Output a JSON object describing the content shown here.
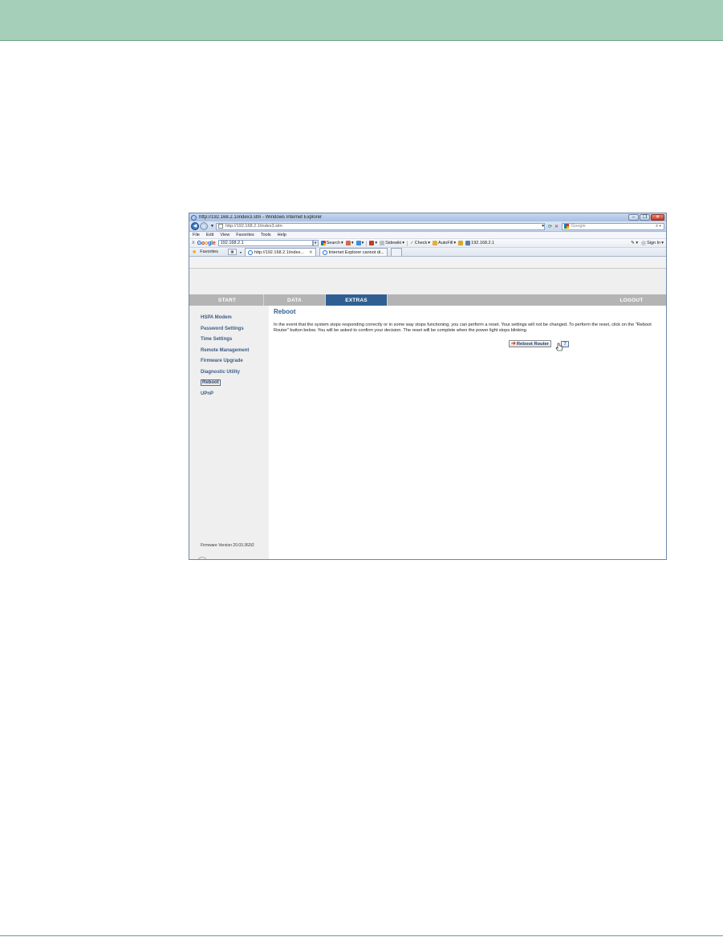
{
  "window": {
    "title": "http://192.168.2.1/index3.stm - Windows Internet Explorer",
    "url": "http://192.168.2.1/index3.stm",
    "search_placeholder": "Google"
  },
  "menu": [
    "File",
    "Edit",
    "View",
    "Favorites",
    "Tools",
    "Help"
  ],
  "google_toolbar": {
    "close": "X",
    "input_value": "192.168.2.1",
    "search_label": "Search",
    "sidewiki_label": "Sidewiki",
    "check_label": "Check",
    "autofill_label": "AutoFill",
    "address_label": "192.168.2.1",
    "signin_label": "Sign In"
  },
  "favorites_bar": {
    "favorites_label": "Favorites",
    "tabs": [
      {
        "label": "http://192.168.2.1/index..."
      },
      {
        "label": "Internet Explorer cannot di..."
      }
    ]
  },
  "router": {
    "nav": {
      "start": "START",
      "data": "DATA",
      "extras": "EXTRAS",
      "logout": "LOGOUT"
    },
    "sidebar": {
      "items": [
        {
          "label": "HSPA Modem"
        },
        {
          "label": "Password Settings"
        },
        {
          "label": "Time Settings"
        },
        {
          "label": "Remote Management"
        },
        {
          "label": "Firmware Upgrade"
        },
        {
          "label": "Diagnostic Utility"
        },
        {
          "label": "Reboot"
        },
        {
          "label": "UPnP"
        }
      ],
      "firmware": "Firmware Version 20.03.362t2"
    },
    "content": {
      "title": "Reboot",
      "text": "In the event that the system stops responding correctly or in some way stops functioning, you can perform a reset. Your settings will not be changed. To perform the reset, click on the \"Reboot Router\" button below. You will be asked to confirm your decision. The reset will be complete when the power light stops blinking.",
      "reboot_button": "Reboot Router",
      "help_button": "?"
    }
  }
}
